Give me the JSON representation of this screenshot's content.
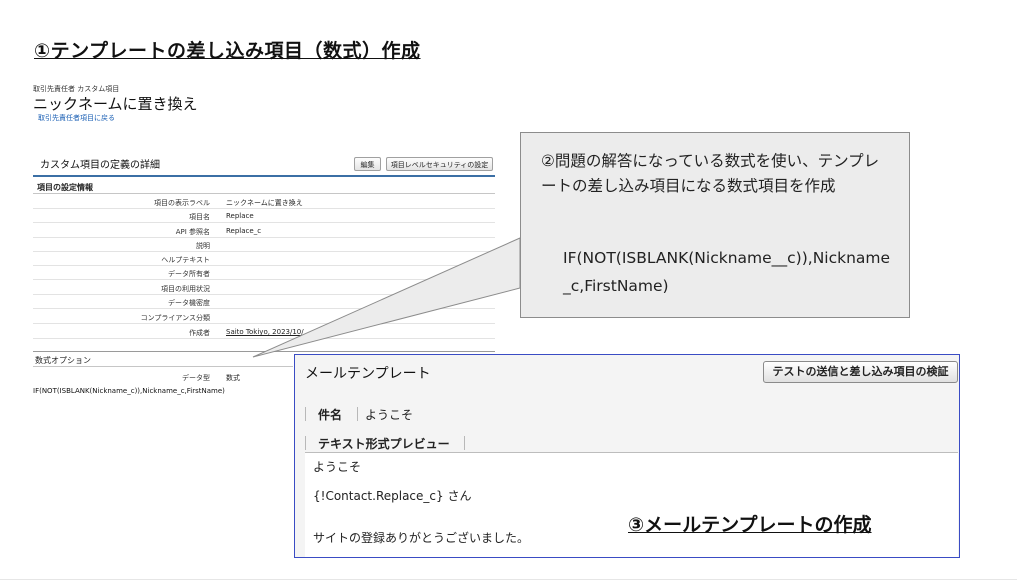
{
  "slide": {
    "title": "①テンプレートの差し込み項目（数式）作成"
  },
  "field_page": {
    "breadcrumb": "取引先責任者 カスタム項目",
    "title": "ニックネームに置き換え",
    "back_link": "取引先責任者項目に戻る",
    "section_title": "カスタム項目の定義の詳細",
    "edit_button": "編集",
    "security_button": "項目レベルセキュリティの設定",
    "info_heading": "項目の設定情報",
    "rows": [
      {
        "label": "項目の表示ラベル",
        "value": "ニックネームに置き換え"
      },
      {
        "label": "項目名",
        "value": "Replace"
      },
      {
        "label": "API 参照名",
        "value": "Replace_c"
      },
      {
        "label": "説明",
        "value": ""
      },
      {
        "label": "ヘルプテキスト",
        "value": ""
      },
      {
        "label": "データ所有者",
        "value": ""
      },
      {
        "label": "項目の利用状況",
        "value": ""
      },
      {
        "label": "データ機密度",
        "value": ""
      },
      {
        "label": "コンプライアンス分類",
        "value": ""
      },
      {
        "label": "作成者",
        "value": "Saito Tokiyo, 2023/10/"
      }
    ],
    "formula_heading": "数式オプション",
    "data_type_label": "データ型",
    "data_type_value": "数式",
    "formula": "IF(NOT(ISBLANK(Nickname_c)),Nickname_c,FirstName)"
  },
  "callout": {
    "text": "②問題の解答になっている数式を使い、テンプレートの差し込み項目になる数式項目を作成",
    "formula": "IF(NOT(ISBLANK(Nickname__c)),Nickname_c,FirstName)"
  },
  "mail_template": {
    "title": "メールテンプレート",
    "test_button": "テストの送信と差し込み項目の検証",
    "subject_label": "件名",
    "subject_value": "ようこそ",
    "preview_tab": "テキスト形式プレビュー",
    "body_line1": "ようこそ",
    "body_line2": "{!Contact.Replace_c} さん",
    "body_line3": "サイトの登録ありがとうございました。",
    "label": "③メールテンプレートの作成"
  },
  "colors": {
    "mail_border": "#3a4cc4",
    "callout_bg": "#ececec",
    "link": "#1a5fb4"
  }
}
